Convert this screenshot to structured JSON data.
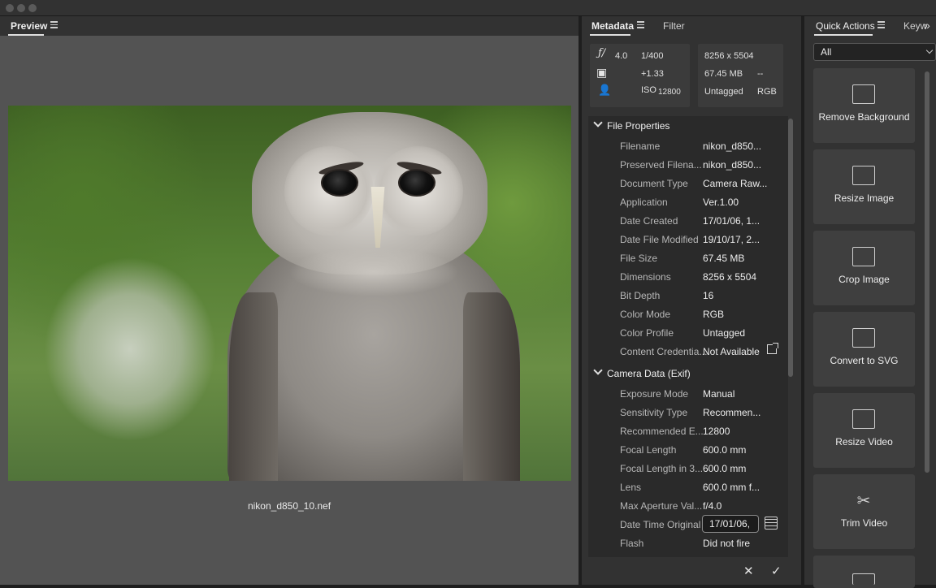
{
  "preview": {
    "tab_label": "Preview",
    "filename": "nikon_d850_10.nef"
  },
  "metadata": {
    "tab_label": "Metadata",
    "filter_label": "Filter",
    "summary": {
      "aperture": "4.0",
      "shutter": "1/400",
      "exposure_comp": "+1.33",
      "iso_label": "ISO",
      "iso_value": "12800",
      "dimensions": "8256 x 5504",
      "file_size": "67.45 MB",
      "dash": "--",
      "profile": "Untagged",
      "color_mode": "RGB"
    },
    "sections": {
      "file_properties": "File Properties",
      "camera_data": "Camera Data (Exif)"
    },
    "file_properties": [
      {
        "key": "Filename",
        "value": "nikon_d850..."
      },
      {
        "key": "Preserved Filena...",
        "value": "nikon_d850..."
      },
      {
        "key": "Document Type",
        "value": "Camera Raw..."
      },
      {
        "key": "Application",
        "value": "Ver.1.00"
      },
      {
        "key": "Date Created",
        "value": "17/01/06, 1..."
      },
      {
        "key": "Date File Modified",
        "value": "19/10/17, 2..."
      },
      {
        "key": "File Size",
        "value": "67.45 MB"
      },
      {
        "key": "Dimensions",
        "value": "8256 x 5504"
      },
      {
        "key": "Bit Depth",
        "value": "16"
      },
      {
        "key": "Color Mode",
        "value": "RGB"
      },
      {
        "key": "Color Profile",
        "value": "Untagged"
      },
      {
        "key": "Content Credentia...",
        "value": "Not Available"
      }
    ],
    "camera_data": [
      {
        "key": "Exposure Mode",
        "value": "Manual"
      },
      {
        "key": "Sensitivity Type",
        "value": "Recommen..."
      },
      {
        "key": "Recommended E...",
        "value": "12800"
      },
      {
        "key": "Focal Length",
        "value": "600.0 mm"
      },
      {
        "key": "Focal Length in 3...",
        "value": "600.0 mm"
      },
      {
        "key": "Lens",
        "value": "600.0 mm f..."
      },
      {
        "key": "Max Aperture Val...",
        "value": "f/4.0"
      },
      {
        "key": "Date Time Original",
        "value": "17/01/06,"
      },
      {
        "key": "Flash",
        "value": "Did not fire"
      }
    ],
    "cancel_glyph": "✕",
    "confirm_glyph": "✓"
  },
  "quick_actions": {
    "tab_label": "Quick Actions",
    "keywords_tab": "Keyw",
    "filter_value": "All",
    "cards": [
      {
        "label": "Remove Background",
        "icon": "image-icon"
      },
      {
        "label": "Resize Image",
        "icon": "resize-image-icon"
      },
      {
        "label": "Crop Image",
        "icon": "crop-image-icon"
      },
      {
        "label": "Convert to SVG",
        "icon": "svg-file-icon"
      },
      {
        "label": "Resize Video",
        "icon": "resize-video-icon"
      },
      {
        "label": "Trim Video",
        "icon": "scissors-icon"
      }
    ]
  }
}
